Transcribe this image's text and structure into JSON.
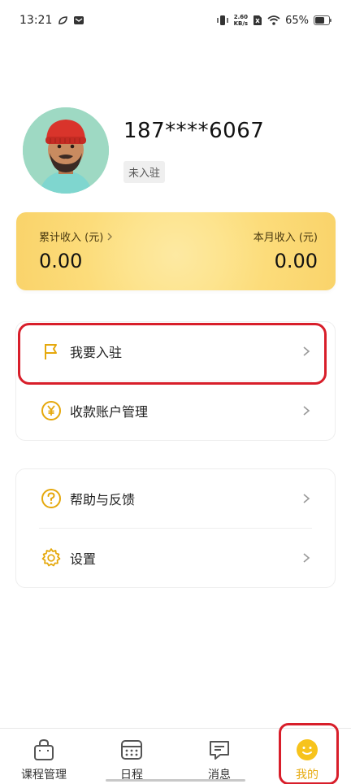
{
  "status_bar": {
    "time": "13:21",
    "net_speed_value": "2.60",
    "net_speed_unit": "KB/s",
    "battery": "65%"
  },
  "profile": {
    "phone": "187****6067",
    "status_tag": "未入驻"
  },
  "income": {
    "total_label": "累计收入 (元)",
    "total_value": "0.00",
    "month_label": "本月收入 (元)",
    "month_value": "0.00"
  },
  "menu_group_1": {
    "items": [
      {
        "label": "我要入驻",
        "icon": "flag-icon"
      },
      {
        "label": "收款账户管理",
        "icon": "yen-icon"
      }
    ]
  },
  "menu_group_2": {
    "items": [
      {
        "label": "帮助与反馈",
        "icon": "question-icon"
      },
      {
        "label": "设置",
        "icon": "gear-icon"
      }
    ]
  },
  "bottom_nav": {
    "items": [
      {
        "label": "课程管理",
        "icon": "bag-icon"
      },
      {
        "label": "日程",
        "icon": "calendar-icon"
      },
      {
        "label": "消息",
        "icon": "message-icon"
      },
      {
        "label": "我的",
        "icon": "smiley-icon",
        "active": true
      }
    ]
  },
  "colors": {
    "accent": "#e7ab10",
    "highlight": "#d81e2a",
    "card": "#fcdc7a"
  }
}
